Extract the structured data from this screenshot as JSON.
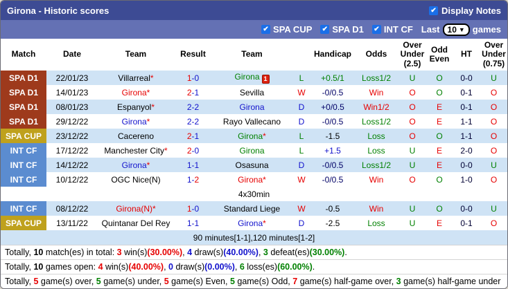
{
  "title_bar": {
    "title": "Girona - Historic scores",
    "display_notes_label": "Display Notes",
    "display_notes_checked": true
  },
  "filter_bar": {
    "filters": [
      {
        "label": "SPA CUP",
        "checked": true
      },
      {
        "label": "SPA D1",
        "checked": true
      },
      {
        "label": "INT CF",
        "checked": true
      }
    ],
    "last_label": "Last",
    "games_count": "10",
    "games_label": "games"
  },
  "colors": {
    "red": "#e60000",
    "green": "#008000",
    "blue": "#1111cc",
    "navy": "#000066",
    "black": "#000000",
    "ht": "#000033",
    "spa_d1": "#9e3a1c",
    "spa_cup": "#bfa11d",
    "int_cf": "#5b8cd0",
    "title_bar_bg": "#3d4b94",
    "filter_bar_bg": "#6471b4",
    "checkbox_blue": "#1a6fe8",
    "row_shade": "#cfe3f5"
  },
  "table": {
    "headers": [
      "Match",
      "Date",
      "Team",
      "Result",
      "Team",
      "",
      "Handicap",
      "Odds",
      "Over Under (2.5)",
      "Odd Even",
      "HT",
      "Over Under (0.75)"
    ],
    "rows": [
      {
        "type": "match",
        "shade": true,
        "league": "SPA D1",
        "league_color": "spa_d1",
        "date": "22/01/23",
        "home": {
          "name": "Villarreal",
          "star": true,
          "color": "black"
        },
        "score": {
          "home": "1",
          "away": "0",
          "home_color": "red",
          "away_color": "blue"
        },
        "away": {
          "name": "Girona",
          "star": false,
          "color": "green",
          "red_card": "1"
        },
        "letter": {
          "text": "L",
          "color": "green"
        },
        "handicap": {
          "text": "+0.5/1",
          "color": "green"
        },
        "odds": {
          "text": "Loss1/2",
          "color": "green"
        },
        "ou25": {
          "text": "U",
          "color": "green"
        },
        "odd_even": {
          "text": "O",
          "color": "green"
        },
        "ht": "0-0",
        "ou075": {
          "text": "U",
          "color": "green"
        }
      },
      {
        "type": "match",
        "shade": false,
        "league": "SPA D1",
        "league_color": "spa_d1",
        "date": "14/01/23",
        "home": {
          "name": "Girona",
          "star": true,
          "color": "red"
        },
        "score": {
          "home": "2",
          "away": "1",
          "home_color": "red",
          "away_color": "blue"
        },
        "away": {
          "name": "Sevilla",
          "star": false,
          "color": "black"
        },
        "letter": {
          "text": "W",
          "color": "red"
        },
        "handicap": {
          "text": "-0/0.5",
          "color": "navy"
        },
        "odds": {
          "text": "Win",
          "color": "red"
        },
        "ou25": {
          "text": "O",
          "color": "red"
        },
        "odd_even": {
          "text": "O",
          "color": "green"
        },
        "ht": "0-1",
        "ou075": {
          "text": "O",
          "color": "red"
        }
      },
      {
        "type": "match",
        "shade": true,
        "league": "SPA D1",
        "league_color": "spa_d1",
        "date": "08/01/23",
        "home": {
          "name": "Espanyol",
          "star": true,
          "color": "black"
        },
        "score": {
          "home": "2",
          "away": "2",
          "home_color": "blue",
          "away_color": "blue"
        },
        "away": {
          "name": "Girona",
          "star": false,
          "color": "blue"
        },
        "letter": {
          "text": "D",
          "color": "blue"
        },
        "handicap": {
          "text": "+0/0.5",
          "color": "navy"
        },
        "odds": {
          "text": "Win1/2",
          "color": "red"
        },
        "ou25": {
          "text": "O",
          "color": "red"
        },
        "odd_even": {
          "text": "E",
          "color": "red"
        },
        "ht": "0-1",
        "ou075": {
          "text": "O",
          "color": "red"
        }
      },
      {
        "type": "match",
        "shade": false,
        "league": "SPA D1",
        "league_color": "spa_d1",
        "date": "29/12/22",
        "home": {
          "name": "Girona",
          "star": true,
          "color": "blue"
        },
        "score": {
          "home": "2",
          "away": "2",
          "home_color": "blue",
          "away_color": "blue"
        },
        "away": {
          "name": "Rayo Vallecano",
          "star": false,
          "color": "black"
        },
        "letter": {
          "text": "D",
          "color": "blue"
        },
        "handicap": {
          "text": "-0/0.5",
          "color": "navy"
        },
        "odds": {
          "text": "Loss1/2",
          "color": "green"
        },
        "ou25": {
          "text": "O",
          "color": "red"
        },
        "odd_even": {
          "text": "E",
          "color": "red"
        },
        "ht": "1-1",
        "ou075": {
          "text": "O",
          "color": "red"
        }
      },
      {
        "type": "match",
        "shade": true,
        "league": "SPA CUP",
        "league_color": "spa_cup",
        "date": "23/12/22",
        "home": {
          "name": "Cacereno",
          "star": false,
          "color": "black"
        },
        "score": {
          "home": "2",
          "away": "1",
          "home_color": "red",
          "away_color": "blue"
        },
        "away": {
          "name": "Girona",
          "star": true,
          "color": "green"
        },
        "letter": {
          "text": "L",
          "color": "green"
        },
        "handicap": {
          "text": "-1.5",
          "color": "black"
        },
        "odds": {
          "text": "Loss",
          "color": "green"
        },
        "ou25": {
          "text": "O",
          "color": "red"
        },
        "odd_even": {
          "text": "O",
          "color": "green"
        },
        "ht": "1-1",
        "ou075": {
          "text": "O",
          "color": "red"
        }
      },
      {
        "type": "match",
        "shade": false,
        "league": "INT CF",
        "league_color": "int_cf",
        "date": "17/12/22",
        "home": {
          "name": "Manchester City",
          "star": true,
          "color": "black"
        },
        "score": {
          "home": "2",
          "away": "0",
          "home_color": "red",
          "away_color": "blue"
        },
        "away": {
          "name": "Girona",
          "star": false,
          "color": "green"
        },
        "letter": {
          "text": "L",
          "color": "green"
        },
        "handicap": {
          "text": "+1.5",
          "color": "blue"
        },
        "odds": {
          "text": "Loss",
          "color": "green"
        },
        "ou25": {
          "text": "U",
          "color": "green"
        },
        "odd_even": {
          "text": "E",
          "color": "red"
        },
        "ht": "2-0",
        "ou075": {
          "text": "O",
          "color": "red"
        }
      },
      {
        "type": "match",
        "shade": true,
        "league": "INT CF",
        "league_color": "int_cf",
        "date": "14/12/22",
        "home": {
          "name": "Girona",
          "star": true,
          "color": "blue"
        },
        "score": {
          "home": "1",
          "away": "1",
          "home_color": "blue",
          "away_color": "blue"
        },
        "away": {
          "name": "Osasuna",
          "star": false,
          "color": "black"
        },
        "letter": {
          "text": "D",
          "color": "blue"
        },
        "handicap": {
          "text": "-0/0.5",
          "color": "navy"
        },
        "odds": {
          "text": "Loss1/2",
          "color": "green"
        },
        "ou25": {
          "text": "U",
          "color": "green"
        },
        "odd_even": {
          "text": "E",
          "color": "red"
        },
        "ht": "0-0",
        "ou075": {
          "text": "U",
          "color": "green"
        }
      },
      {
        "type": "match",
        "shade": false,
        "league": "INT CF",
        "league_color": "int_cf",
        "date": "10/12/22",
        "home": {
          "name": "OGC Nice(N)",
          "star": false,
          "color": "black"
        },
        "score": {
          "home": "1",
          "away": "2",
          "home_color": "blue",
          "away_color": "red"
        },
        "away": {
          "name": "Girona",
          "star": true,
          "color": "red"
        },
        "letter": {
          "text": "W",
          "color": "red"
        },
        "handicap": {
          "text": "-0/0.5",
          "color": "navy"
        },
        "odds": {
          "text": "Win",
          "color": "red"
        },
        "ou25": {
          "text": "O",
          "color": "red"
        },
        "odd_even": {
          "text": "O",
          "color": "green"
        },
        "ht": "1-0",
        "ou075": {
          "text": "O",
          "color": "red"
        }
      },
      {
        "type": "note",
        "shade": false,
        "text": "4x30min"
      },
      {
        "type": "match",
        "shade": true,
        "league": "INT CF",
        "league_color": "int_cf",
        "date": "08/12/22",
        "home": {
          "name": "Girona(N)",
          "star": true,
          "color": "red"
        },
        "score": {
          "home": "1",
          "away": "0",
          "home_color": "red",
          "away_color": "blue"
        },
        "away": {
          "name": "Standard Liege",
          "star": false,
          "color": "black"
        },
        "letter": {
          "text": "W",
          "color": "red"
        },
        "handicap": {
          "text": "-0.5",
          "color": "black"
        },
        "odds": {
          "text": "Win",
          "color": "red"
        },
        "ou25": {
          "text": "U",
          "color": "green"
        },
        "odd_even": {
          "text": "O",
          "color": "green"
        },
        "ht": "0-0",
        "ou075": {
          "text": "U",
          "color": "green"
        }
      },
      {
        "type": "match",
        "shade": false,
        "league": "SPA CUP",
        "league_color": "spa_cup",
        "date": "13/11/22",
        "home": {
          "name": "Quintanar Del Rey",
          "star": false,
          "color": "black"
        },
        "score": {
          "home": "1",
          "away": "1",
          "home_color": "blue",
          "away_color": "blue"
        },
        "away": {
          "name": "Girona",
          "star": true,
          "color": "blue"
        },
        "letter": {
          "text": "D",
          "color": "blue"
        },
        "handicap": {
          "text": "-2.5",
          "color": "black"
        },
        "odds": {
          "text": "Loss",
          "color": "green"
        },
        "ou25": {
          "text": "U",
          "color": "green"
        },
        "odd_even": {
          "text": "E",
          "color": "red"
        },
        "ht": "0-1",
        "ou075": {
          "text": "O",
          "color": "red"
        }
      },
      {
        "type": "note",
        "shade": true,
        "text": "90 minutes[1-1],120 minutes[1-2]"
      }
    ]
  },
  "summary": [
    [
      {
        "text": "Totally, "
      },
      {
        "text": "10",
        "bold": true
      },
      {
        "text": " match(es) in total: "
      },
      {
        "text": "3",
        "color": "red",
        "bold": true
      },
      {
        "text": " win(s)"
      },
      {
        "text": "(30.00%)",
        "color": "red",
        "bold": true
      },
      {
        "text": ", "
      },
      {
        "text": "4",
        "color": "blue",
        "bold": true
      },
      {
        "text": " draw(s)"
      },
      {
        "text": "(40.00%)",
        "color": "blue",
        "bold": true
      },
      {
        "text": ", "
      },
      {
        "text": "3",
        "color": "green",
        "bold": true
      },
      {
        "text": " defeat(es)"
      },
      {
        "text": "(30.00%)",
        "color": "green",
        "bold": true
      },
      {
        "text": "."
      }
    ],
    [
      {
        "text": "Totally, "
      },
      {
        "text": "10",
        "bold": true
      },
      {
        "text": " games open: "
      },
      {
        "text": "4",
        "color": "red",
        "bold": true
      },
      {
        "text": " win(s)"
      },
      {
        "text": "(40.00%)",
        "color": "red",
        "bold": true
      },
      {
        "text": ", "
      },
      {
        "text": "0",
        "color": "blue",
        "bold": true
      },
      {
        "text": " draw(s)"
      },
      {
        "text": "(0.00%)",
        "color": "blue",
        "bold": true
      },
      {
        "text": ", "
      },
      {
        "text": "6",
        "color": "green",
        "bold": true
      },
      {
        "text": " loss(es)"
      },
      {
        "text": "(60.00%)",
        "color": "green",
        "bold": true
      },
      {
        "text": "."
      }
    ],
    [
      {
        "text": "Totally, "
      },
      {
        "text": "5",
        "color": "red",
        "bold": true
      },
      {
        "text": " game(s) over, "
      },
      {
        "text": "5",
        "color": "green",
        "bold": true
      },
      {
        "text": " game(s) under, "
      },
      {
        "text": "5",
        "color": "red",
        "bold": true
      },
      {
        "text": " game(s) Even, "
      },
      {
        "text": "5",
        "color": "green",
        "bold": true
      },
      {
        "text": " game(s) Odd, "
      },
      {
        "text": "7",
        "color": "red",
        "bold": true
      },
      {
        "text": " game(s) half-game over, "
      },
      {
        "text": "3",
        "color": "green",
        "bold": true
      },
      {
        "text": " game(s) half-game under"
      }
    ]
  ]
}
